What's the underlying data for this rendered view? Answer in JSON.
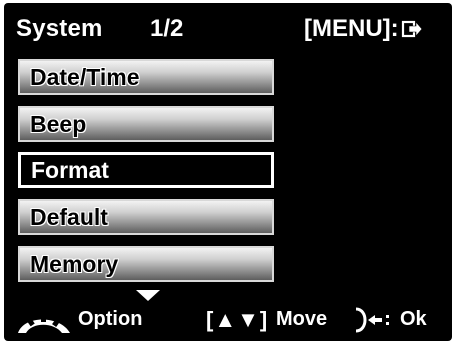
{
  "header": {
    "title": "System",
    "page": "1/2",
    "menu_hint": "[MENU]:"
  },
  "menu": {
    "items": [
      {
        "label": "Date/Time",
        "selected": false
      },
      {
        "label": "Beep",
        "selected": false
      },
      {
        "label": "Format",
        "selected": true
      },
      {
        "label": "Default",
        "selected": false
      },
      {
        "label": "Memory",
        "selected": false
      }
    ]
  },
  "footer": {
    "option_label": "Option",
    "move_glyph": "[▲▼]",
    "move_label": "Move",
    "ok_label": "Ok"
  },
  "icons": {
    "exit": "exit-arrow-icon",
    "option": "dial-icon",
    "ok": "shutter-ok-icon",
    "scroll": "scroll-down-triangle-icon"
  },
  "colors": {
    "background": "#000000",
    "text": "#ffffff",
    "item_gradient_top": "#f2f2f2",
    "item_gradient_bottom": "#5e5e5e"
  }
}
